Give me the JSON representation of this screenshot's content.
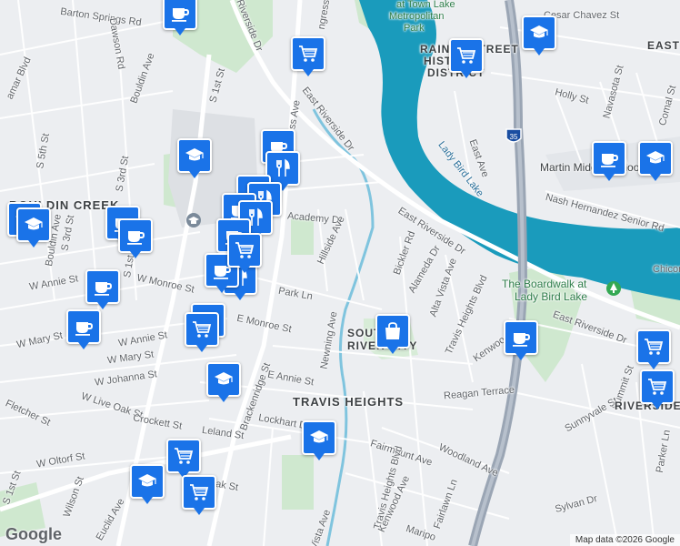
{
  "map": {
    "attribution": "Map data ©2026 Google",
    "logo": "Google",
    "accent": "#1a73e8",
    "water_color": "#1a9bbc",
    "park_color": "#c8e6c9"
  },
  "labels": {
    "barton_springs_rd": "Barton Springs Rd",
    "dawson_rd": "Dawson Rd",
    "bouldin_ave_n": "Bouldin Ave",
    "lamar_blvd": "amar Blvd",
    "s_1st_st_n": "S 1st St",
    "riverside_dr_n": "Riverside Dr",
    "congress_n": "ngress",
    "town_lake": "at Town Lake",
    "metro_park": "Metropolitan",
    "park": "Park",
    "rainey_1": "RAINEY STREET",
    "rainey_2": "HISTORIC",
    "rainey_3": "DISTRICT",
    "cesar_chavez": "Cesar Chavez St",
    "east_label": "EAST",
    "holly_st": "Holly St",
    "navasota_st": "Navasota St",
    "comal_st": "Comal St",
    "east_ave": "East Ave",
    "hwy_35": "35",
    "lady_bird_lake": "Lady Bird Lake",
    "martin_middle": "Martin Middle School",
    "nash_hernandez": "Nash Hernandez Senior Rd",
    "chicon": "Chicon",
    "boardwalk_1": "The Boardwalk at",
    "boardwalk_2": "Lady Bird Lake",
    "e_riverside_dr_1": "East Riverside Dr",
    "e_riverside_dr_2": "East Riverside Dr",
    "e_riverside_dr_3": "East Riverside Dr",
    "bouldin_creek": "BOULDIN CREEK",
    "s_5th_st": "S 5th St",
    "s_3rd_st": "S 3rd St",
    "s_1st_st_mid": "S 1st St",
    "bouldin_ave_w": "Bouldin Ave",
    "s_3rd_st_w": "S 3rd St",
    "w_annie_st": "W Annie St",
    "w_mary_st": "W Mary St",
    "w_monroe_st": "W Monroe St",
    "e_monroe_st": "E Monroe St",
    "w_annie_st_2": "W Annie St",
    "w_mary_st_2": "W Mary St",
    "w_johanna_st": "W Johanna St",
    "w_live_oak_st": "W Live Oak St",
    "fletcher_st": "Fletcher St",
    "crockett_st": "Crockett St",
    "leland_st": "Leland St",
    "w_oltorf_st": "W Oltorf St",
    "s_1st_st_s": "S 1st St",
    "wilson_st": "Wilson St",
    "euclid_ave": "Euclid Ave",
    "academy_dr": "Academy Dr",
    "hillside_ave": "Hillside Ave",
    "park_ln": "Park Ln",
    "newning_ave": "Newning Ave",
    "brackenridge_st": "Brackenridge St",
    "e_annie_st": "E Annie St",
    "lockhart_dr": "Lockhart Dr",
    "bickler_rd": "Bickler Rd",
    "alameda_dr": "Alameda Dr",
    "alta_vista_ave": "Alta Vista Ave",
    "travis_heights_blvd": "Travis Heights Blvd",
    "south_river_city_1": "SOUTH",
    "south_river_city_2": "RIVER CITY",
    "travis_heights": "TRAVIS HEIGHTS",
    "reagan_terrace": "Reagan Terrace",
    "kenwood_ave": "Kenwood Ave",
    "summit_st": "Summit St",
    "sunnyvale_st": "Sunnyvale St",
    "riverside": "RIVERSIDE",
    "parker_ln": "Parker Ln",
    "fairmount_ave": "Fairmount Ave",
    "woodland_ave": "Woodland Ave",
    "travis_heights_blvd_2": "Travis Heights Blvd",
    "kenwood_ave_2": "Kenwood Ave",
    "fairlawn_ln": "Fairlawn Ln",
    "sylvan_dr": "Sylvan Dr",
    "mariposa": "Maripo",
    "vista_ave": "Vista Ave",
    "live_oak_st": "ve Oak St",
    "ss_ave": "ss Ave"
  },
  "pins": [
    {
      "type": "coffee-icon"
    },
    {
      "type": "cart-icon"
    },
    {
      "type": "cart-icon"
    },
    {
      "type": "school-icon"
    },
    {
      "type": "school-icon"
    },
    {
      "type": "coffee-icon"
    },
    {
      "type": "restaurant-icon"
    },
    {
      "type": "coffee-icon"
    },
    {
      "type": "school-icon"
    },
    {
      "type": "restaurant-icon"
    },
    {
      "type": "restaurant-icon"
    },
    {
      "type": "coffee-icon"
    },
    {
      "type": "school-icon"
    },
    {
      "type": "school-icon"
    },
    {
      "type": "coffee-icon"
    },
    {
      "type": "coffee-icon"
    },
    {
      "type": "restaurant-icon"
    },
    {
      "type": "coffee-icon"
    },
    {
      "type": "restaurant-icon"
    },
    {
      "type": "coffee-icon"
    },
    {
      "type": "cart-icon"
    },
    {
      "type": "cart-icon"
    },
    {
      "type": "school-icon"
    },
    {
      "type": "school-icon"
    },
    {
      "type": "cart-icon"
    },
    {
      "type": "school-icon"
    },
    {
      "type": "cart-icon"
    },
    {
      "type": "cart-icon"
    },
    {
      "type": "shopping-bag-icon"
    },
    {
      "type": "coffee-icon"
    },
    {
      "type": "cart-icon"
    },
    {
      "type": "cart-icon"
    },
    {
      "type": "coffee-icon"
    },
    {
      "type": "coffee-icon"
    }
  ]
}
